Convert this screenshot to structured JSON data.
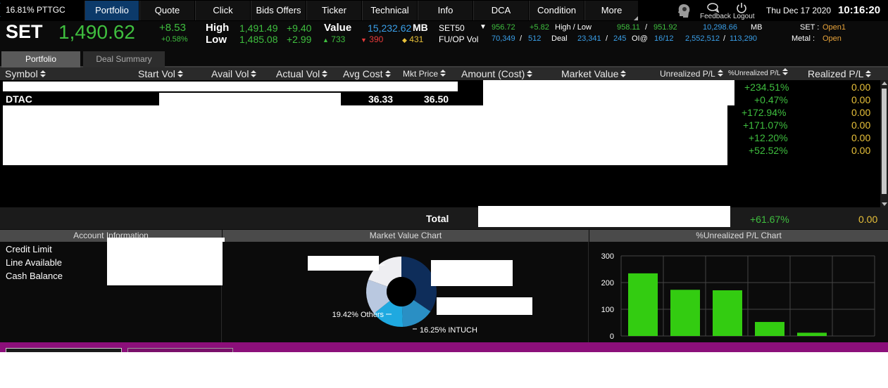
{
  "topnav": {
    "ticker_chip": "16.81% PTTGC",
    "tabs": [
      {
        "label": "Portfolio",
        "active": true
      },
      {
        "label": "Quote"
      },
      {
        "label": "Click"
      },
      {
        "label": "Bids Offers"
      },
      {
        "label": "Ticker"
      },
      {
        "label": "Technical"
      },
      {
        "label": "Info"
      },
      {
        "label": "DCA"
      },
      {
        "label": "Condition"
      },
      {
        "label": "More"
      }
    ],
    "feedback_label": "Feedback",
    "logout_label": "Logout",
    "date": "Thu Dec 17 2020",
    "time": "10:16:20"
  },
  "index": {
    "name": "SET",
    "value": "1,490.62",
    "change": "+8.53",
    "change_pct": "+0.58%",
    "high_label": "High",
    "low_label": "Low",
    "high": "1,491.49",
    "high_chg": "+9.40",
    "low": "1,485.08",
    "low_chg": "+2.99",
    "value_label": "Value",
    "value_amount": "15,232.62",
    "value_unit": "MB",
    "up_count": "733",
    "down_count": "390",
    "unch_count": "431",
    "set50_label": "SET50",
    "set50_value": "956.72",
    "set50_chg": "+5.82",
    "hl_label": "High / Low",
    "set50_high": "958.11",
    "set50_low": "951.92",
    "set50_val": "10,298.66",
    "set50_unit": "MB",
    "fuop_label": "FU/OP Vol",
    "fuop_vol1": "70,349",
    "fuop_vol2": "512",
    "deal_label": "Deal",
    "deal1": "23,341",
    "deal2": "245",
    "oi_label": "OI@",
    "oi1": "16/12",
    "oi_val1": "2,552,512",
    "oi_val2": "113,290",
    "set_status_label": "SET :",
    "set_status": "Open1",
    "metal_label": "Metal :",
    "metal_status": "Open"
  },
  "subtabs": {
    "portfolio": "Portfolio",
    "deal_summary": "Deal Summary"
  },
  "table": {
    "headers": {
      "symbol": "Symbol",
      "start_vol": "Start Vol",
      "avail_vol": "Avail Vol",
      "actual_vol": "Actual Vol",
      "avg_cost": "Avg Cost",
      "mkt_price": "Mkt Price",
      "amount_cost": "Amount (Cost)",
      "market_value": "Market Value",
      "unrealized_pl": "Unrealized P/L",
      "pct_unrealized_pl": "%Unrealized P/L",
      "realized_pl": "Realized P/L"
    },
    "rows": [
      {
        "symbol": "",
        "avg_cost": "",
        "mkt_price": "",
        "pct_unrealized": "+234.51%",
        "realized": "0.00"
      },
      {
        "symbol": "DTAC",
        "avg_cost": "36.33",
        "mkt_price": "36.50",
        "pct_unrealized": "+0.47%",
        "realized": "0.00"
      },
      {
        "symbol": "",
        "avg_cost": "",
        "mkt_price": "",
        "pct_unrealized": "+172.94%",
        "realized": "0.00"
      },
      {
        "symbol": "",
        "avg_cost": "",
        "mkt_price": "",
        "pct_unrealized": "+171.07%",
        "realized": "0.00"
      },
      {
        "symbol": "",
        "avg_cost": "",
        "mkt_price": "",
        "pct_unrealized": "+12.20%",
        "realized": "0.00"
      },
      {
        "symbol": "",
        "avg_cost": "",
        "mkt_price": "",
        "pct_unrealized": "+52.52%",
        "realized": "0.00"
      }
    ],
    "total_label": "Total",
    "total_pct_unrealized": "+61.67%",
    "total_realized": "0.00"
  },
  "account": {
    "title": "Account Information",
    "credit_limit_label": "Credit Limit",
    "line_available_label": "Line Available",
    "cash_balance_label": "Cash Balance"
  },
  "colors": {
    "positive": "#3fbf3f",
    "realized": "#e8c13a",
    "bar_fill": "#33cc11",
    "nav_active": "#0c3a6a",
    "footer": "#8c0f7a"
  },
  "chart_data": [
    {
      "type": "pie",
      "title": "Market Value Chart",
      "labels": [
        "16.25% INTUCH",
        "19.42% Others"
      ],
      "slices": [
        {
          "label": "",
          "value": 34.5,
          "color": "#0e2d5a"
        },
        {
          "label": "",
          "value": 14.8,
          "color": "#2a8fc4"
        },
        {
          "label": "",
          "value": 15.0,
          "color": "#1fa9e0"
        },
        {
          "label": "INTUCH",
          "value": 16.25,
          "color": "#b9c8e0"
        },
        {
          "label": "Others",
          "value": 19.42,
          "color": "#eeeef2"
        }
      ]
    },
    {
      "type": "bar",
      "title": "%Unrealized P/L Chart",
      "ylim": [
        0,
        300
      ],
      "yticks": [
        "0",
        "100",
        "200",
        "300"
      ],
      "values": [
        234.51,
        172.94,
        171.07,
        52.52,
        12.2
      ],
      "grid": true
    }
  ]
}
